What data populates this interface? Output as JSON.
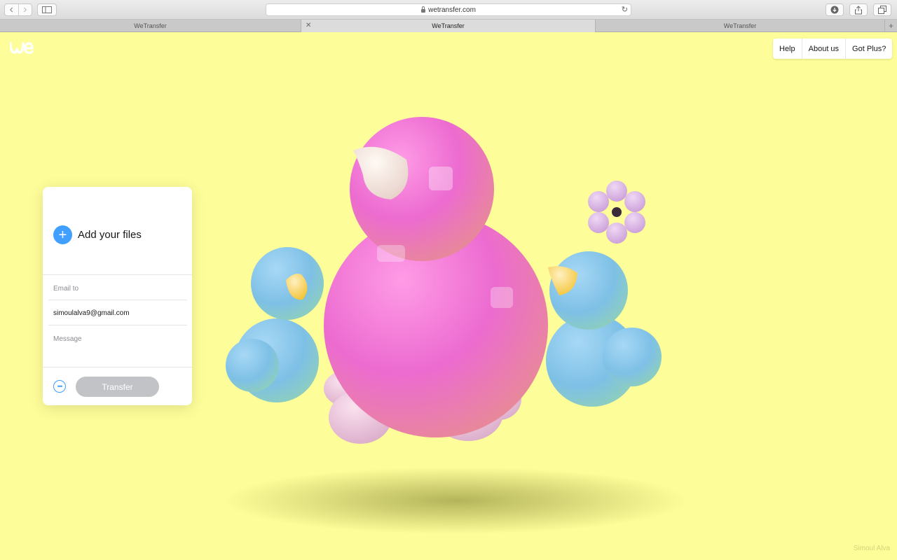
{
  "browser": {
    "url": "wetransfer.com",
    "tabs": [
      {
        "title": "WeTransfer",
        "active": false
      },
      {
        "title": "WeTransfer",
        "active": true
      },
      {
        "title": "WeTransfer",
        "active": false
      }
    ],
    "new_tab_glyph": "+"
  },
  "header": {
    "logo_icon": "wetransfer-logo-icon",
    "nav": [
      {
        "label": "Help"
      },
      {
        "label": "About us"
      },
      {
        "label": "Got Plus?"
      }
    ]
  },
  "upload_panel": {
    "add_files_label": "Add your files",
    "email_to_placeholder": "Email to",
    "your_email_value": "simoulalva9@gmail.com",
    "message_placeholder": "Message",
    "transfer_label": "Transfer"
  },
  "background": {
    "color": "#fdfd99",
    "credit": "Simoul Alva"
  },
  "colors": {
    "accent": "#409fff",
    "button_disabled": "#c2c3c6"
  }
}
